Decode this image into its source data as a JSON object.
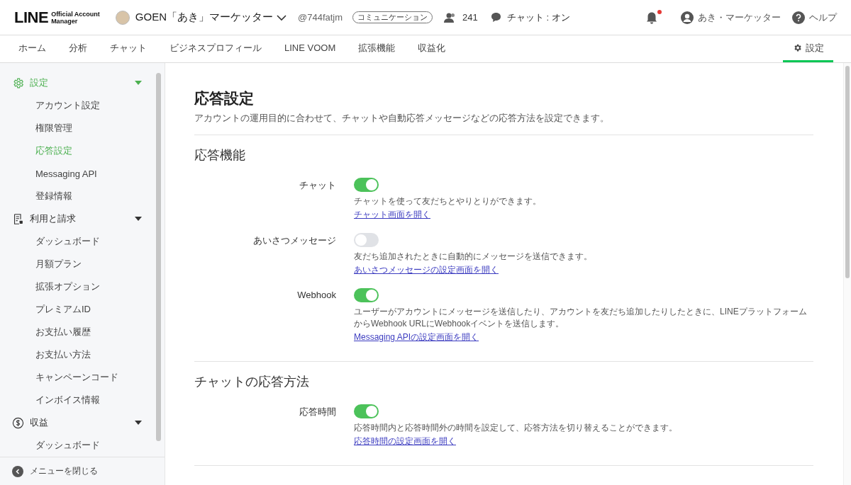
{
  "header": {
    "logo_main": "LINE",
    "logo_sub_1": "Official Account",
    "logo_sub_2": "Manager",
    "account_name": "GOEN「あき」マーケッター",
    "account_id": "@744fatjm",
    "account_type": "コミュニケーション",
    "friends_count": "241",
    "chat_status": "チャット : オン",
    "notification": {
      "unread": true
    },
    "user_name": "あき・マーケッター",
    "help": "ヘルプ"
  },
  "tabs": [
    {
      "label": "ホーム",
      "selected": false
    },
    {
      "label": "分析",
      "selected": false
    },
    {
      "label": "チャット",
      "selected": false
    },
    {
      "label": "ビジネスプロフィール",
      "selected": false
    },
    {
      "label": "LINE VOOM",
      "selected": false
    },
    {
      "label": "拡張機能",
      "selected": false
    },
    {
      "label": "収益化",
      "selected": false
    }
  ],
  "settings_tab": {
    "label": "設定",
    "selected": true
  },
  "sidebar": {
    "groups": [
      {
        "label": "設定",
        "expanded": true,
        "selected": true,
        "children": [
          {
            "label": "アカウント設定",
            "selected": false
          },
          {
            "label": "権限管理",
            "selected": false
          },
          {
            "label": "応答設定",
            "selected": true
          },
          {
            "label": "Messaging API",
            "selected": false
          },
          {
            "label": "登録情報",
            "selected": false
          }
        ]
      },
      {
        "label": "利用と請求",
        "expanded": true,
        "selected": false,
        "children": [
          {
            "label": "ダッシュボード",
            "selected": false
          },
          {
            "label": "月額プラン",
            "selected": false
          },
          {
            "label": "拡張オプション",
            "selected": false
          },
          {
            "label": "プレミアムID",
            "selected": false
          },
          {
            "label": "お支払い履歴",
            "selected": false
          },
          {
            "label": "お支払い方法",
            "selected": false
          },
          {
            "label": "キャンペーンコード",
            "selected": false
          },
          {
            "label": "インボイス情報",
            "selected": false
          }
        ]
      },
      {
        "label": "収益",
        "expanded": true,
        "selected": false,
        "children": [
          {
            "label": "ダッシュボード",
            "selected": false
          }
        ]
      }
    ],
    "close_menu": "メニューを閉じる"
  },
  "page": {
    "title": "応答設定",
    "subtitle": "アカウントの運用目的に合わせて、チャットや自動応答メッセージなどの応答方法を設定できます。",
    "sections": [
      {
        "heading": "応答機能",
        "settings": [
          {
            "label": "チャット",
            "on": true,
            "description": "チャットを使って友だちとやりとりができます。",
            "link": "チャット画面を開く"
          },
          {
            "label": "あいさつメッセージ",
            "on": false,
            "description": "友だち追加されたときに自動的にメッセージを送信できます。",
            "link": "あいさつメッセージの設定画面を開く"
          },
          {
            "label": "Webhook",
            "on": true,
            "description": "ユーザーがアカウントにメッセージを送信したり、アカウントを友だち追加したりしたときに、LINEプラットフォームからWebhook URLにWebhookイベントを送信します。",
            "link": "Messaging APIの設定画面を開く"
          }
        ]
      },
      {
        "heading": "チャットの応答方法",
        "settings": [
          {
            "label": "応答時間",
            "on": true,
            "description": "応答時間内と応答時間外の時間を設定して、応答方法を切り替えることができます。",
            "link": "応答時間の設定画面を開く"
          }
        ]
      }
    ]
  }
}
